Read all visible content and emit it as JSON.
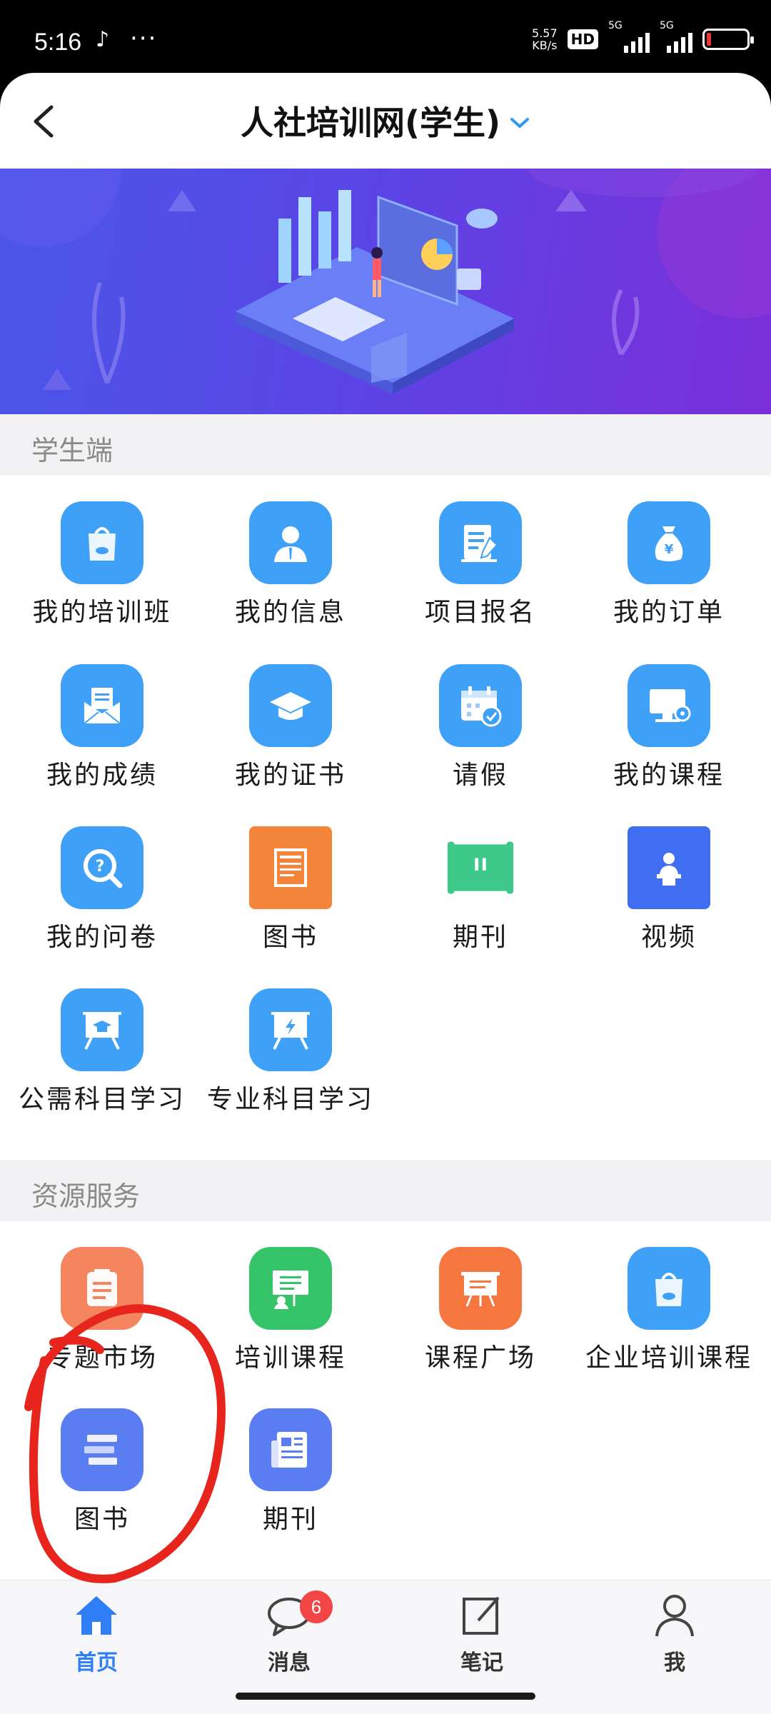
{
  "status_bar": {
    "time": "5:16",
    "dots": "···",
    "net_speed": "5.57",
    "net_speed_unit": "KB/s",
    "hd": "HD",
    "sim1": "5G",
    "sim2": "5G"
  },
  "header": {
    "title": "人社培训网(学生)"
  },
  "student_section": {
    "title": "学生端",
    "items": [
      {
        "label": "我的培训班",
        "icon": "bag-icon",
        "color": "#3ea0f7"
      },
      {
        "label": "我的信息",
        "icon": "person-icon",
        "color": "#3ea0f7"
      },
      {
        "label": "项目报名",
        "icon": "form-edit-icon",
        "color": "#3ea0f7"
      },
      {
        "label": "我的订单",
        "icon": "money-bag-icon",
        "color": "#3ea0f7"
      },
      {
        "label": "我的成绩",
        "icon": "envelope-icon",
        "color": "#3ea0f7"
      },
      {
        "label": "我的证书",
        "icon": "graduation-cap-icon",
        "color": "#3ea0f7"
      },
      {
        "label": "请假",
        "icon": "calendar-check-icon",
        "color": "#3ea0f7"
      },
      {
        "label": "我的课程",
        "icon": "monitor-icon",
        "color": "#3ea0f7"
      },
      {
        "label": "我的问卷",
        "icon": "question-search-icon",
        "color": "#3ea0f7"
      },
      {
        "label": "图书",
        "icon": "book-icon",
        "color": "#f5853a"
      },
      {
        "label": "期刊",
        "icon": "scroll-icon",
        "color": "#3ec98a"
      },
      {
        "label": "视频",
        "icon": "lecturer-icon",
        "color": "#3f6ff0"
      },
      {
        "label": "公需科目学习",
        "icon": "board-cap-icon",
        "color": "#3ea0f7"
      },
      {
        "label": "专业科目学习",
        "icon": "board-bolt-icon",
        "color": "#3ea0f7"
      }
    ]
  },
  "resource_section": {
    "title": "资源服务",
    "items": [
      {
        "label": "专题市场",
        "icon": "note-icon",
        "color": "#f5855f"
      },
      {
        "label": "培训课程",
        "icon": "training-board-icon",
        "color": "#35c46a"
      },
      {
        "label": "课程广场",
        "icon": "easel-icon",
        "color": "#f5763f"
      },
      {
        "label": "企业培训课程",
        "icon": "bag-icon",
        "color": "#3ea0f7"
      },
      {
        "label": "图书",
        "icon": "books-stack-icon",
        "color": "#5b7df2"
      },
      {
        "label": "期刊",
        "icon": "newspaper-icon",
        "color": "#5b7df2"
      }
    ]
  },
  "bottom_nav": {
    "items": [
      {
        "label": "首页",
        "icon": "home-icon",
        "active": true
      },
      {
        "label": "消息",
        "icon": "chat-bubble-icon",
        "badge": "6"
      },
      {
        "label": "笔记",
        "icon": "note-edit-icon"
      },
      {
        "label": "我",
        "icon": "user-icon"
      }
    ]
  },
  "colors": {
    "accent": "#2f7ef5",
    "annotation": "#e8251c",
    "badge": "#f24646"
  }
}
